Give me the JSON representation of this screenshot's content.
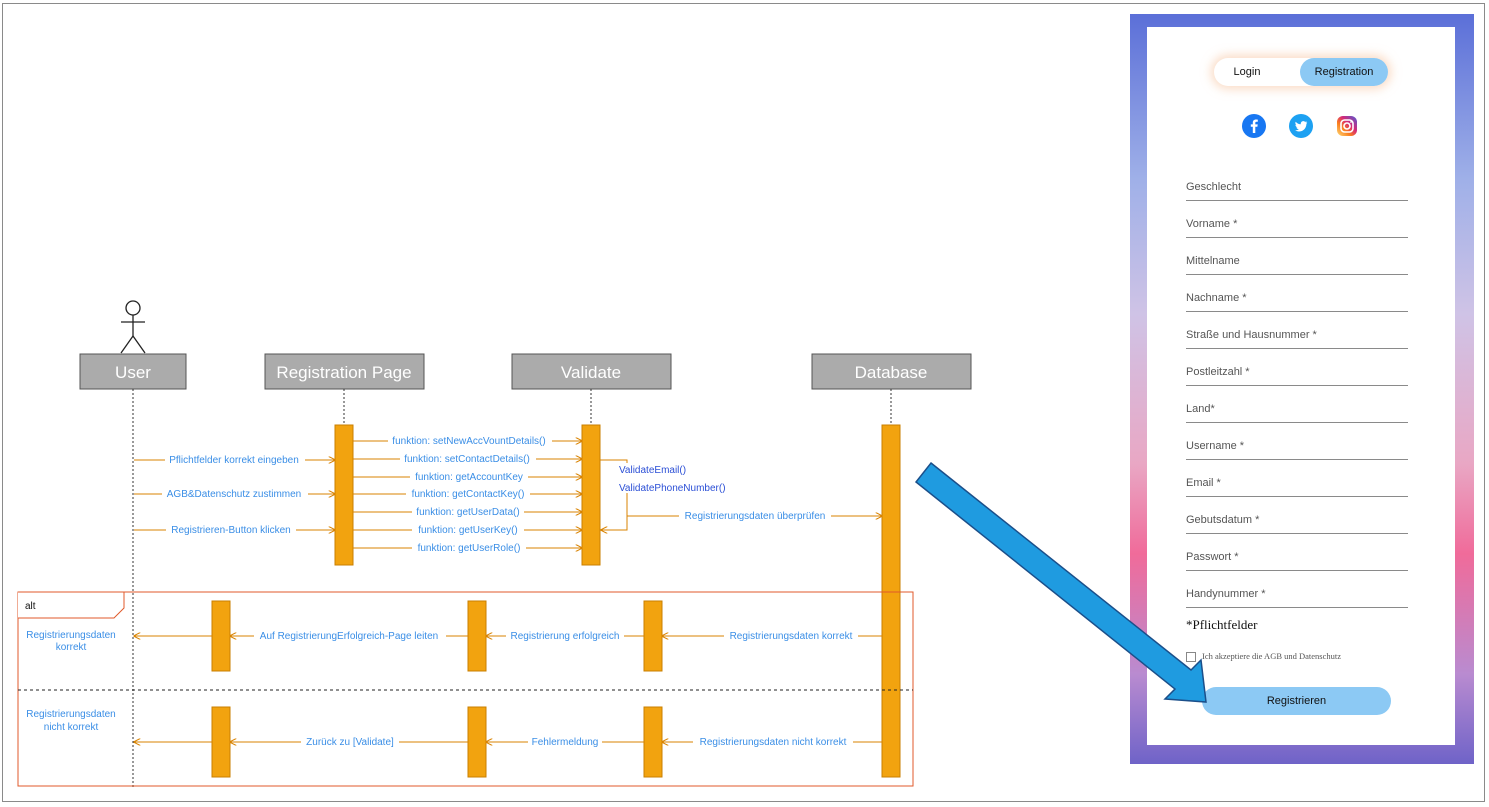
{
  "diagram": {
    "actors": [
      {
        "id": "user",
        "label": "User"
      },
      {
        "id": "page",
        "label": "Registration Page"
      },
      {
        "id": "validate",
        "label": "Validate"
      },
      {
        "id": "db",
        "label": "Database"
      }
    ],
    "user_to_page": [
      "Pflichtfelder korrekt eingeben",
      "AGB&Datenschutz zustimmen",
      "Registrieren-Button klicken"
    ],
    "page_to_validate": [
      "funktion: setNewAccVountDetails()",
      "funktion: setContactDetails()",
      "funktion: getAccountKey",
      "funktion: getContactKey()",
      "funktion: getUserData()",
      "funktion: getUserKey()",
      "funktion: getUserRole()"
    ],
    "self_calls": [
      "ValidateEmail()",
      "ValidatePhoneNumber()"
    ],
    "validate_to_db": "Registrierungsdaten überprüfen",
    "alt": {
      "label": "alt",
      "success": {
        "db_to_validate": "Registrierungsdaten korrekt",
        "validate_to_page": "Registrierung erfolgreich",
        "page_to_user": "Auf RegistrierungErfolgreich-Page leiten",
        "note_line1": "Registrierungsdaten",
        "note_line2": "korrekt"
      },
      "failure": {
        "db_to_validate": "Registrierungsdaten nicht korrekt",
        "validate_to_page": "Fehlermeldung",
        "page_to_user": "Zurück zu [Validate]",
        "note_line1": "Registrierungsdaten",
        "note_line2": "nicht korrekt"
      }
    },
    "colors": {
      "activation": "#f2a30f",
      "message": "#d98300",
      "label": "#3a8ee6",
      "frame": "#e05a2b",
      "arrow": "#1f9be0"
    }
  },
  "form": {
    "tabs": {
      "login": "Login",
      "registration": "Registration",
      "active": "registration"
    },
    "social": [
      "facebook-icon",
      "twitter-icon",
      "instagram-icon"
    ],
    "fields": [
      "Geschlecht",
      "Vorname *",
      "Mittelname",
      "Nachname *",
      "Straße und Hausnummer *",
      "Postleitzahl *",
      "Land*",
      "Username *",
      "Email *",
      "Gebutsdatum *",
      "Passwort *",
      "Handynummer *"
    ],
    "required_note": "*Pflichtfelder",
    "agb_checkbox": "Ich akzeptiere die AGB und Datenschutz",
    "submit": "Registrieren"
  }
}
